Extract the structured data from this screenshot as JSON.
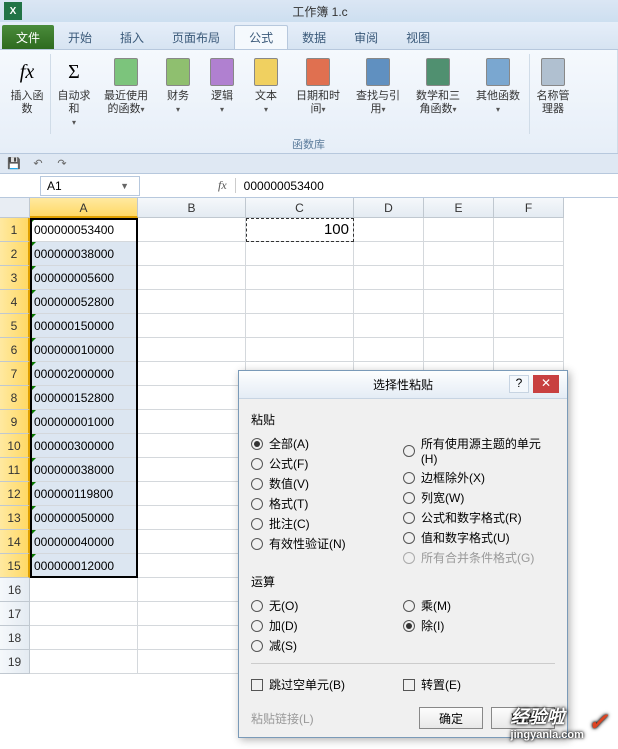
{
  "title": "工作簿 1.c",
  "tabs": {
    "file": "文件",
    "home": "开始",
    "insert": "插入",
    "layout": "页面布局",
    "formula": "公式",
    "data": "数据",
    "review": "审阅",
    "view": "视图"
  },
  "ribbon": {
    "insert_fn": "插入函数",
    "autosum": "自动求和",
    "recent": "最近使用的函数",
    "financial": "财务",
    "logical": "逻辑",
    "text": "文本",
    "datetime": "日期和时间",
    "lookup": "查找与引用",
    "math": "数学和三角函数",
    "more": "其他函数",
    "name_mgr": "名称管理器",
    "group_label": "函数库",
    "fx_symbol": "fx",
    "sigma": "Σ"
  },
  "namebox": "A1",
  "formula_fx": "fx",
  "formula_value": "000000053400",
  "columns": [
    "A",
    "B",
    "C",
    "D",
    "E",
    "F"
  ],
  "cells_a": [
    "000000053400",
    "000000038000",
    "000000005600",
    "000000052800",
    "000000150000",
    "000000010000",
    "000002000000",
    "000000152800",
    "000000001000",
    "000000300000",
    "000000038000",
    "000000119800",
    "000000050000",
    "000000040000",
    "000000012000"
  ],
  "cell_c1": "100",
  "dialog": {
    "title": "选择性粘贴",
    "paste_label": "粘贴",
    "all": "全部(A)",
    "formulas": "公式(F)",
    "values": "数值(V)",
    "formats": "格式(T)",
    "comments": "批注(C)",
    "validation": "有效性验证(N)",
    "theme": "所有使用源主题的单元(H)",
    "noborder": "边框除外(X)",
    "colwidth": "列宽(W)",
    "formnum": "公式和数字格式(R)",
    "valnum": "值和数字格式(U)",
    "merge": "所有合并条件格式(G)",
    "op_label": "运算",
    "none": "无(O)",
    "add": "加(D)",
    "sub": "减(S)",
    "mul": "乘(M)",
    "div": "除(I)",
    "skip": "跳过空单元(B)",
    "transpose": "转置(E)",
    "pastelink": "粘贴链接(L)",
    "ok": "确定",
    "cancel": "取消"
  },
  "watermark": {
    "text": "经验啦",
    "url": "jingyanla.com"
  }
}
